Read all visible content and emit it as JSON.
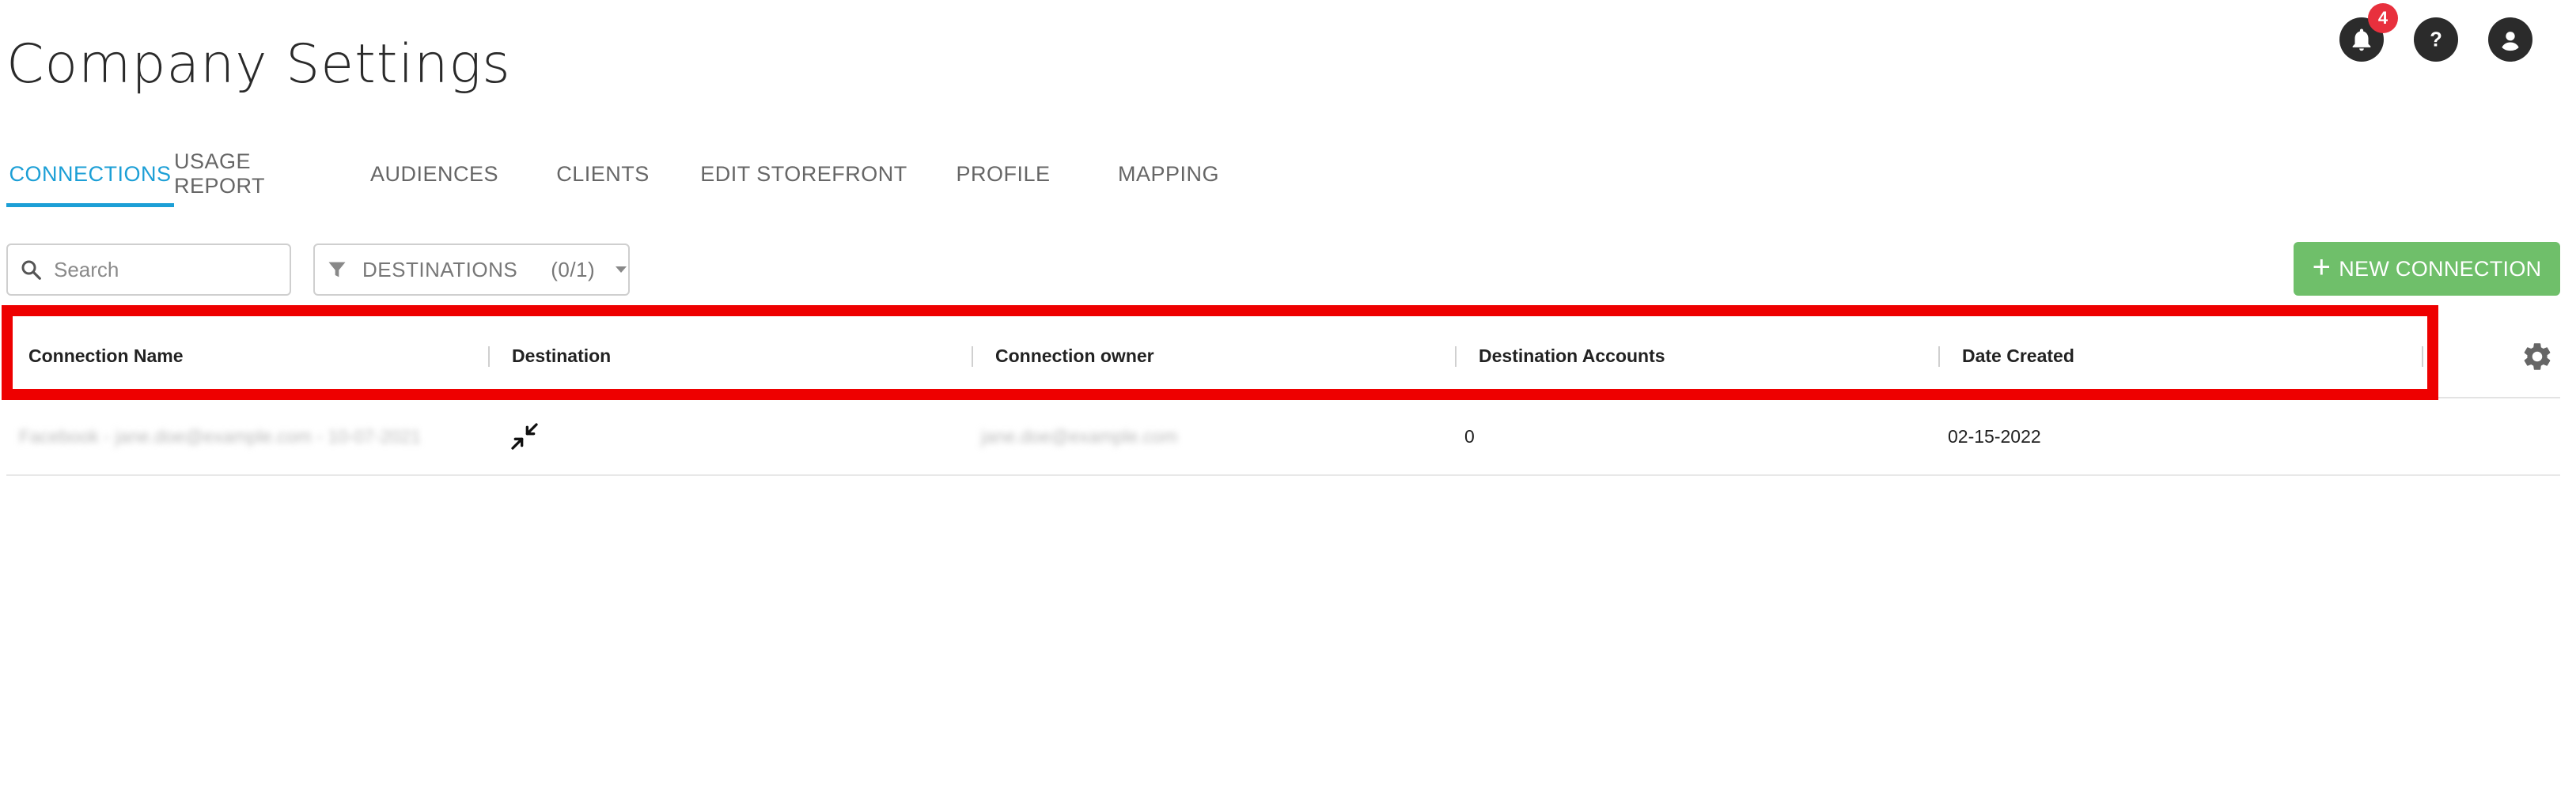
{
  "page": {
    "title": "Company Settings"
  },
  "header": {
    "notifications_count": "4"
  },
  "tabs": [
    {
      "label": "CONNECTIONS",
      "active": true
    },
    {
      "label": "USAGE REPORT",
      "active": false
    },
    {
      "label": "AUDIENCES",
      "active": false
    },
    {
      "label": "CLIENTS",
      "active": false
    },
    {
      "label": "EDIT STOREFRONT",
      "active": false
    },
    {
      "label": "PROFILE",
      "active": false
    },
    {
      "label": "MAPPING",
      "active": false
    }
  ],
  "toolbar": {
    "search_placeholder": "Search",
    "filter_label": "DESTINATIONS",
    "filter_count": "(0/1)",
    "new_connection_label": "NEW CONNECTION"
  },
  "table": {
    "columns": [
      "Connection Name",
      "Destination",
      "Connection owner",
      "Destination Accounts",
      "Date Created"
    ],
    "rows": [
      {
        "connection_name": "Facebook - jane.doe@example.com - 10-07-2021",
        "destination_icon": "compress-arrows-icon",
        "connection_owner": "jane.doe@example.com",
        "destination_accounts": "0",
        "date_created": "02-15-2022"
      }
    ]
  },
  "colors": {
    "accent": "#1c9fd6",
    "button_green": "#6fbf6a",
    "badge_red": "#e8303d",
    "highlight_red": "#ee0000"
  },
  "icons": {
    "notifications": "bell-icon",
    "help": "help-icon",
    "account": "account-circle-icon",
    "search": "search-icon",
    "filter": "filter-icon",
    "settings": "gear-icon"
  }
}
